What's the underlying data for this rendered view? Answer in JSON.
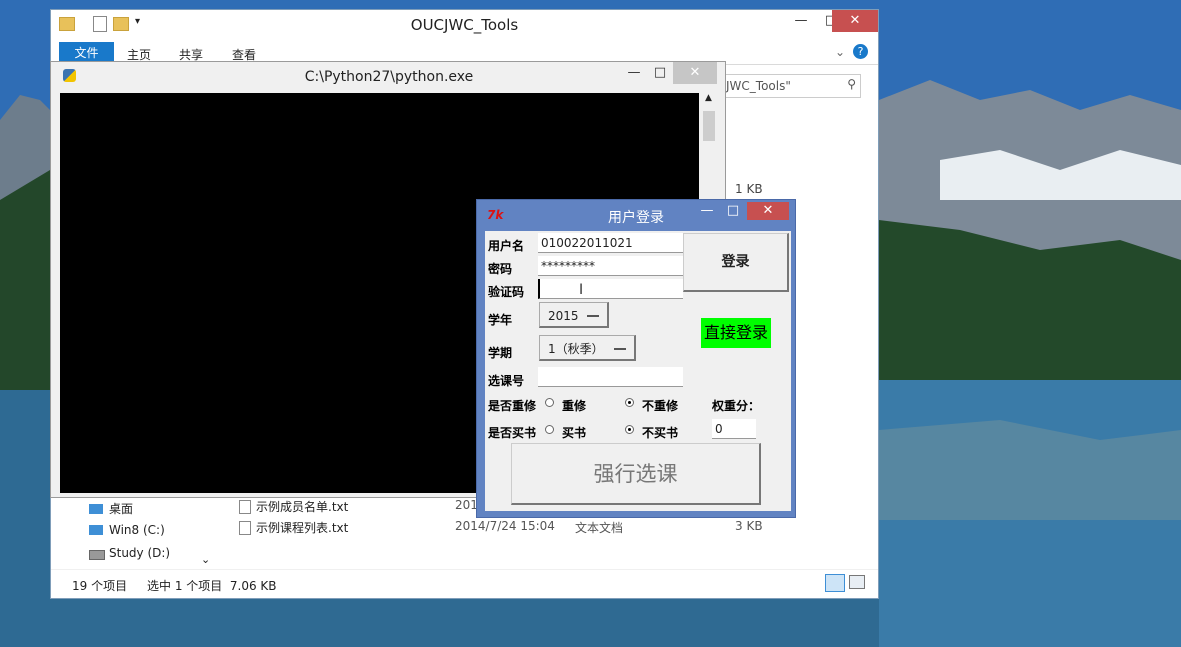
{
  "explorer": {
    "title": "OUCJWC_Tools",
    "ribbon_tabs": [
      "文件",
      "主页",
      "共享",
      "查看"
    ],
    "search_placeholder": "JWC_Tools\"",
    "size_top": "1 KB",
    "nav": [
      "桌面",
      "Win8 (C:)",
      "Study (D:)"
    ],
    "files": [
      {
        "name": "示例成员名单.txt",
        "date": "201",
        "type": "",
        "size": ""
      },
      {
        "name": "示例课程列表.txt",
        "date": "2014/7/24 15:04",
        "type": "文本文档",
        "size": "3 KB"
      }
    ],
    "status_count": "19 个项目",
    "status_selected": "选中 1 个项目  7.06 KB"
  },
  "python_window": {
    "title": "C:\\Python27\\python.exe"
  },
  "login": {
    "title": "用户登录",
    "username_label": "用户名",
    "username_value": "010022011021",
    "password_label": "密码",
    "password_value": "*********",
    "captcha_label": "验证码",
    "captcha_value": "",
    "login_button": "登录",
    "year_label": "学年",
    "year_value": "2015",
    "direct_login": "直接登录",
    "term_label": "学期",
    "term_value": "1（秋季）",
    "course_label": "选课号",
    "course_value": "",
    "retake_label": "是否重修",
    "retake_yes": "重修",
    "retake_no": "不重修",
    "weight_label": "权重分：",
    "weight_value": "0",
    "buybook_label": "是否买书",
    "buybook_yes": "买书",
    "buybook_no": "不买书",
    "force_button": "强行选课",
    "colors": {
      "direct_login_bg": "#00ff00",
      "titlebar": "#6183c2",
      "close": "#c75050"
    }
  }
}
